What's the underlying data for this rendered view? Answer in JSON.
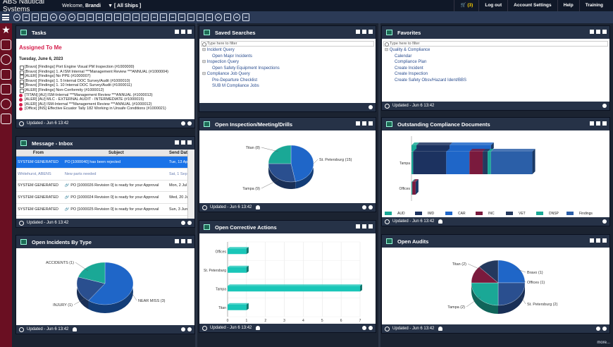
{
  "app": {
    "brand": "ABS Nautical Systems",
    "welcome_prefix": "Welcome,",
    "user": "Brandi",
    "ships": "[ All Ships ]",
    "cart_count": "(3)",
    "nav": [
      "Log out",
      "Account Settings",
      "Help",
      "Training"
    ]
  },
  "tasks": {
    "title": "Tasks",
    "heading": "Assigned To Me",
    "date": "Tuesday, June 6, 2023",
    "items": [
      {
        "text": "[Bravo] [Findings] Port Engine Visual PM Inspection (#1000000)",
        "style": "cb"
      },
      {
        "text": "[Bravo] [Findings] 1. A ISM Internal ***Management Review ***ANNUAL (#1000004)",
        "style": "cb"
      },
      {
        "text": "[ALER] [Findings] No PPE (#1000007)",
        "style": "cb"
      },
      {
        "text": "[Bravo] [Findings] 1. 5 Internal DOC Survey/Audit (#1000010)",
        "style": "cb"
      },
      {
        "text": "[Bravo] [Findings] 1. 10 Internal DOC Survey/Audit (#1000011)",
        "style": "cb"
      },
      {
        "text": "[ALER] [Findings] Non-Conformity (#1000012)",
        "style": "cb"
      },
      {
        "text": "[TITAN] [AU] ISM-Internal ***Management Review ***ANNUAL (#1000013)",
        "style": "rd"
      },
      {
        "text": "[ALER] [AU] MLC - EXTERNAL AUDIT - INTERMEDIATE (#1000015)",
        "style": "rd"
      },
      {
        "text": "[ALER] [AU] ISM-Internal ***Management Review ***ANNUAL (#1000012)",
        "style": "rd"
      },
      {
        "text": "[Office] [INS] Effective Ecuator Tally 182 Working in Unsafe Conditions (#1000021)",
        "style": "rd"
      }
    ],
    "footer": "Updated - Jun 6 13:42"
  },
  "inbox": {
    "title": "Message - Inbox",
    "columns": [
      "From",
      "Subject",
      "Send Date"
    ],
    "rows": [
      {
        "from": "SYSTEM GENERATED",
        "subject": "PO [1000040] has been rejected",
        "date": "Tue, 13 Apr 2...",
        "attach": false,
        "state": "sel"
      },
      {
        "from": "Whitehurst, ABENS",
        "subject": "New parts needed",
        "date": "Sat, 1 Sep 20...",
        "attach": false,
        "state": "muted"
      },
      {
        "from": "SYSTEM GENERATED",
        "subject": "PO [1000026 Revision 0] is ready for your Approval",
        "date": "Mon, 2 Jul 20...",
        "attach": true,
        "state": ""
      },
      {
        "from": "SYSTEM GENERATED",
        "subject": "PO [1000024 Revision 0] is ready for your Approval",
        "date": "Wed, 20 Jun ...",
        "attach": true,
        "state": ""
      },
      {
        "from": "SYSTEM GENERATED",
        "subject": "PO [1000025 Revision 0] is ready for your Approval",
        "date": "Sun, 3 Jun 20...",
        "attach": true,
        "state": ""
      },
      {
        "from": "SYSTEM GENERATED",
        "subject": "PO [1000023 Revision 0] is ready for your Approval",
        "date": "Sun, 3 Jun 20...",
        "attach": true,
        "state": ""
      }
    ],
    "footer": "Updated - Jun 6 13:42"
  },
  "saved_searches": {
    "title": "Saved Searches",
    "filter_placeholder": "Type here to filter",
    "tree": [
      {
        "group": "Incident Query",
        "leaves": [
          "Open Major Incidents"
        ]
      },
      {
        "group": "Inspection Query",
        "leaves": [
          "Open Safety Equipment Inspections"
        ]
      },
      {
        "group": "Compliance Job Query",
        "leaves": [
          "Pre-Departure Checklist",
          "SUB M Compliance Jobs"
        ]
      }
    ]
  },
  "favorites": {
    "title": "Favorites",
    "filter_placeholder": "Type here to filter",
    "tree": [
      {
        "group": "Quality & Compliance",
        "leaves": [
          "Calendar",
          "Compliance Plan",
          "Create Incident",
          "Create Inspection",
          "Create Safety Obsv/Hazard Ident/BBS"
        ]
      }
    ],
    "footer": "Updated - Jun 6 13:42"
  },
  "charts": {
    "open_inspection": {
      "title": "Open Inspection/Meeting/Drills",
      "footer": "Updated - Jun 6 13:42",
      "chart_data": {
        "type": "pie",
        "slices": [
          {
            "label": "St. Petersburg (15)",
            "value": 15,
            "color": "#1f66c8"
          },
          {
            "label": "Tampa (9)",
            "value": 9,
            "color": "#2a4f8f"
          },
          {
            "label": "Titan (8)",
            "value": 8,
            "color": "#1aa896"
          }
        ]
      }
    },
    "outstanding_compliance": {
      "title": "Outstanding Compliance Documents",
      "footer": "Updated - Jun 6 13:42",
      "chart_data": {
        "type": "bar",
        "orientation": "horizontal",
        "stacked": true,
        "categories": [
          "",
          "Tampa",
          "Offices"
        ],
        "series": [
          {
            "name": "AUD",
            "color": "#1aa896",
            "values": [
              3,
              1,
              0.5
            ]
          },
          {
            "name": "IMD",
            "color": "#1c3260",
            "values": [
              20,
              20,
              0
            ]
          },
          {
            "name": "CAR",
            "color": "#1f66c8",
            "values": [
              25,
              14,
              0
            ]
          },
          {
            "name": "INC",
            "color": "#7a1a3d",
            "values": [
              0,
              8,
              2
            ]
          },
          {
            "name": "VET",
            "color": "#24395e",
            "values": [
              0,
              3,
              0
            ]
          },
          {
            "name": "DNSP",
            "color": "#1aa896",
            "values": [
              0,
              2,
              0
            ]
          },
          {
            "name": "Findings",
            "color": "#2b5fa8",
            "values": [
              0,
              25,
              0
            ]
          }
        ]
      }
    },
    "open_incidents": {
      "title": "Open Incidents By Type",
      "footer": "Updated - Jun 6 13:42",
      "chart_data": {
        "type": "pie",
        "slices": [
          {
            "label": "NEAR MISS (3)",
            "value": 3,
            "color": "#1f66c8"
          },
          {
            "label": "INJURY (1)",
            "value": 1,
            "color": "#2a4f8f"
          },
          {
            "label": "ACCIDENTS (1)",
            "value": 1,
            "color": "#1aa896"
          }
        ]
      }
    },
    "open_corrective": {
      "title": "Open Corrective Actions",
      "footer": "Updated - Jun 6 13:42",
      "chart_data": {
        "type": "bar",
        "orientation": "horizontal",
        "categories": [
          "Offices",
          "St. Petersburg",
          "Tampa",
          "Titan"
        ],
        "values": [
          1,
          1,
          7,
          1
        ],
        "xlim": [
          0,
          7
        ],
        "xticks": [
          "0",
          "1",
          "2",
          "3",
          "4",
          "5",
          "6",
          "7"
        ],
        "color": "#19c6b8"
      }
    },
    "open_audits": {
      "title": "Open Audits",
      "footer": "Updated - Jun 6 13:42",
      "chart_data": {
        "type": "pie",
        "slices": [
          {
            "label": "St. Petersburg (2)",
            "value": 2,
            "color": "#1f66c8"
          },
          {
            "label": "Tampa (2)",
            "value": 2,
            "color": "#2a4f8f"
          },
          {
            "label": "Titan (2)",
            "value": 2,
            "color": "#1aa896"
          },
          {
            "label": "Offices (1)",
            "value": 1,
            "color": "#7a1a3d"
          },
          {
            "label": "Bravo (1)",
            "value": 1,
            "color": "#24395e"
          }
        ]
      }
    }
  },
  "footer_more": "more..."
}
